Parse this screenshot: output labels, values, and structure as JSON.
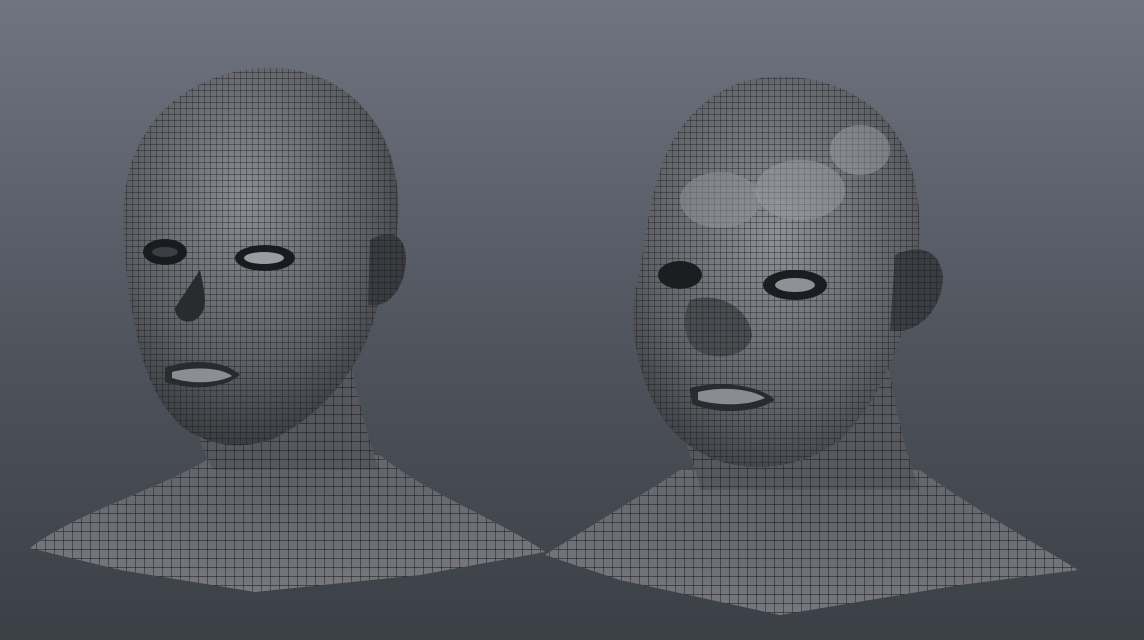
{
  "viewport": {
    "background_top": "#6f7480",
    "background_bottom": "#3b3f46",
    "mesh_fill_base": "#5a5c62",
    "mesh_line_color": "#141518"
  },
  "models": [
    {
      "id": "head-base",
      "description_name": "base-head-mesh"
    },
    {
      "id": "head-creature",
      "description_name": "creature-head-mesh"
    }
  ]
}
